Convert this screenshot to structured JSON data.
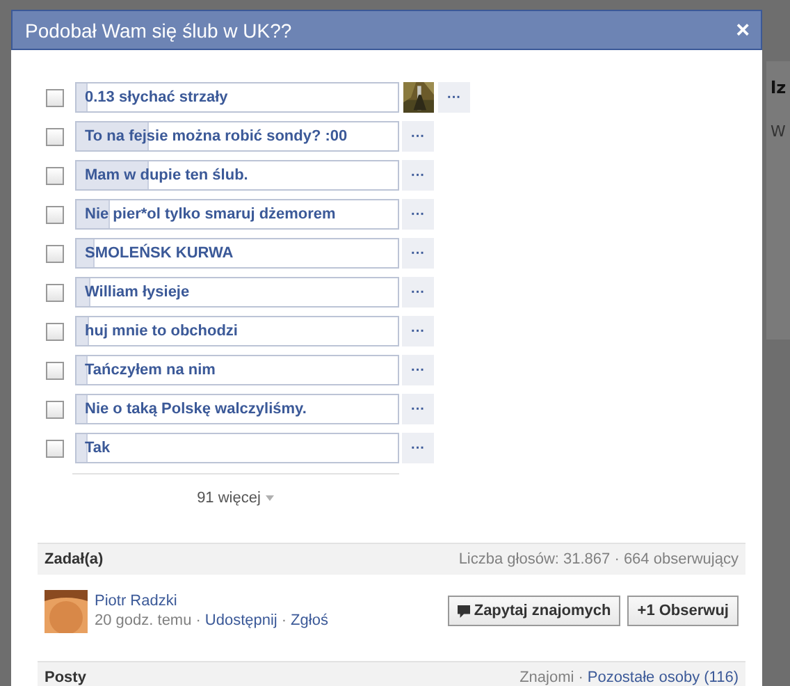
{
  "background": {
    "fragments": [
      "lz",
      "W"
    ]
  },
  "dialog": {
    "title": "Podobał Wam się ślub w UK??",
    "close": "×"
  },
  "options": [
    {
      "label": "0.13 słychać strzały",
      "checked": false,
      "level": 0.03,
      "kind": "picture",
      "more": "···"
    },
    {
      "label": "To na fejsie można robić sondy? :00",
      "checked": false,
      "level": 0.22,
      "kind": "plain",
      "more": "···"
    },
    {
      "label": "Mam w dupie ten ślub.",
      "checked": false,
      "level": 0.22,
      "kind": "plain",
      "more": "···"
    },
    {
      "label": "Nie pier*ol tylko smaruj dżemorem",
      "checked": false,
      "level": 0.1,
      "kind": "plain",
      "more": "···"
    },
    {
      "label": "SMOLEŃSK KURWA",
      "checked": false,
      "level": 0.05,
      "kind": "plain",
      "more": "···"
    },
    {
      "label": "William łysieje",
      "checked": false,
      "level": 0.04,
      "kind": "plain",
      "more": "···"
    },
    {
      "label": "huj mnie to obchodzi",
      "checked": false,
      "level": 0.035,
      "kind": "plain",
      "more": "···"
    },
    {
      "label": "Tańczyłem na nim",
      "checked": false,
      "level": 0.03,
      "kind": "plain",
      "more": "···"
    },
    {
      "label": "Nie o taką Polskę walczyliśmy.",
      "checked": false,
      "level": 0.03,
      "kind": "plain",
      "more": "···"
    },
    {
      "label": "Tak",
      "checked": false,
      "level": 0.03,
      "kind": "plain",
      "more": "···"
    }
  ],
  "more_link": "91 więcej",
  "asker": {
    "heading": "Zadał(a)",
    "stats": "Liczba głosów: 31.867 · 664 obserwujący",
    "name": "Piotr Radzki",
    "time": "20 godz. temu",
    "share": "Udostępnij",
    "report": "Zgłoś",
    "separators": [
      "·",
      "·"
    ],
    "ask_button": "Zapytaj znajomych",
    "follow_button": "+1 Obserwuj"
  },
  "posts": {
    "heading": "Posty",
    "friends": "Znajomi",
    "separator": "·",
    "others": "Pozostałe osoby (116)"
  }
}
